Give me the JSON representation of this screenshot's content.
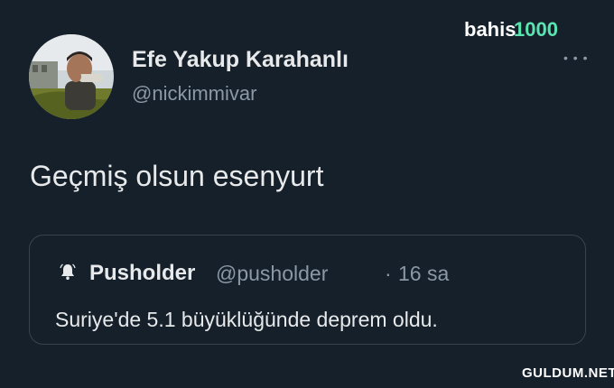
{
  "tweet": {
    "author_name": "Efe Yakup Karahanlı",
    "author_handle": "@nickimmivar",
    "text": "Geçmiş olsun esenyurt"
  },
  "quoted_tweet": {
    "author_name": "Pusholder",
    "author_handle": "@pusholder",
    "separator": "·",
    "time": "16 sa",
    "text": "Suriye'de 5.1 büyüklüğünde deprem oldu.",
    "avatar_icon": "bell-icon"
  },
  "brand_watermark": {
    "logo_text": "bahis1000",
    "color": "#ffffff",
    "accent": "#5be3b0"
  },
  "site_watermark": "GULDUM.NET",
  "more_icon": "ellipsis-icon",
  "colors": {
    "background": "#15202b",
    "text": "#e7e9ea",
    "secondary_text": "#8b98a5",
    "border": "#38444d"
  }
}
